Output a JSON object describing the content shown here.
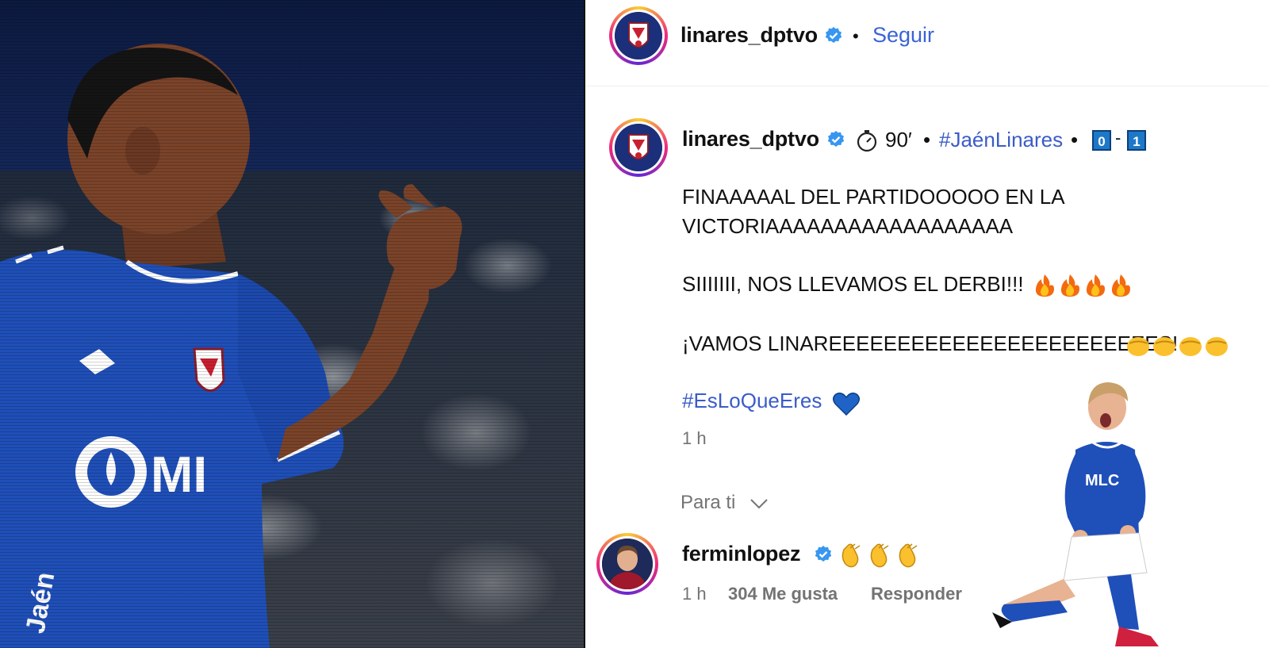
{
  "header": {
    "username": "linares_dptvo",
    "separator": "•",
    "follow_label": "Seguir"
  },
  "post": {
    "username": "linares_dptvo",
    "minute": "90′",
    "sep1": "•",
    "hashtag_match": "#JaénLinares",
    "sep2": "•",
    "score_home": "0",
    "score_dash": "-",
    "score_away": "1",
    "line1": "FINAAAAAL DEL PARTIDOOOOO EN LA",
    "line2": "VICTORIAAAAAAAAAAAAAAAAAA",
    "line3": "SIIIIIII, NOS LLEVAMOS EL DERBI!!!",
    "line4": "¡VAMOS LINAREEEEEEEEEEEEEEEEEEEEEEEES!",
    "hashtag_club": "#EsLoQueEres",
    "time": "1 h"
  },
  "section_label": "Para ti",
  "comment": {
    "username": "ferminlopez",
    "time": "1 h",
    "likes": "304 Me gusta",
    "reply_label": "Responder"
  },
  "colors": {
    "link": "#3b5cc8",
    "follow": "#3b63d6",
    "verified": "#3797f0",
    "jersey": "#1f4fb8"
  },
  "icons": [
    "verified-icon",
    "stopwatch-icon",
    "fire-emoji-icon",
    "clap-emoji-icon",
    "blue-heart-icon",
    "chevron-down-icon"
  ]
}
